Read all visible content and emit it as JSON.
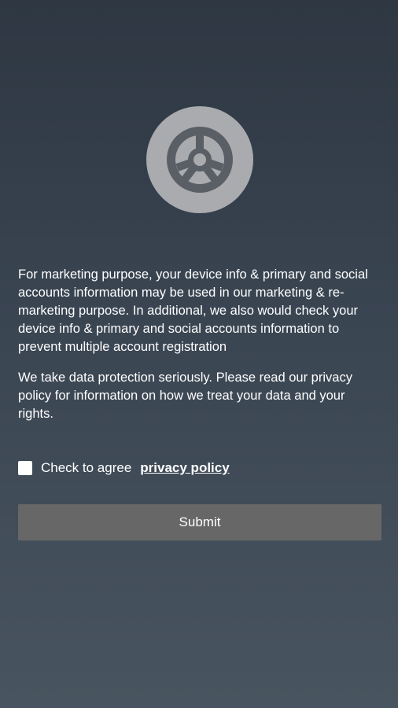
{
  "logo": {
    "icon": "steering-wheel-icon",
    "bg_color": "#a9abae",
    "fg_color": "#5a5f66"
  },
  "consent": {
    "paragraph_1": "For marketing purpose, your device info & primary and social accounts information may be used in our marketing & re-marketing purpose. In additional, we also would check your device info & primary and social accounts information to prevent multiple account registration",
    "paragraph_2": "We take data protection seriously. Please read our privacy policy for information on how we treat your data and your rights.",
    "checkbox_label": "Check to agree",
    "checkbox_checked": false,
    "policy_link": "privacy policy"
  },
  "submit_button": {
    "label": "Submit",
    "color": "#676767"
  }
}
